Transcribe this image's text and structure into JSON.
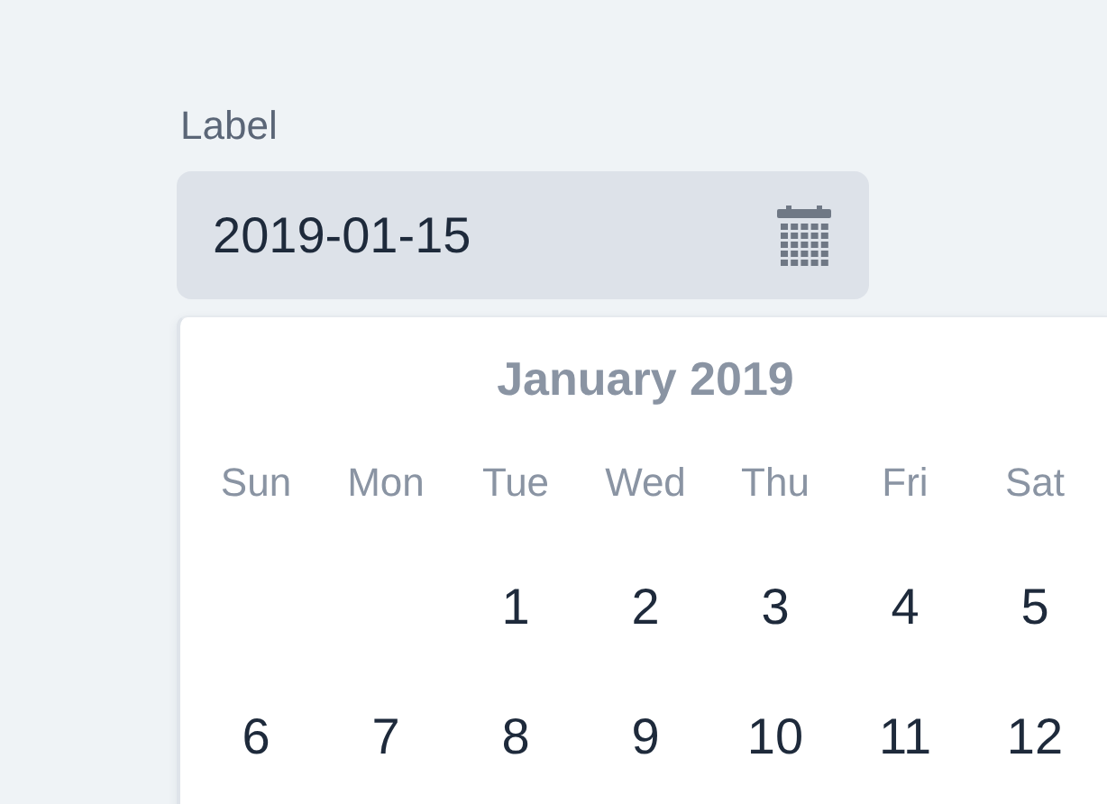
{
  "field": {
    "label": "Label",
    "value": "2019-01-15"
  },
  "calendar": {
    "title": "January 2019",
    "weekdays": [
      "Sun",
      "Mon",
      "Tue",
      "Wed",
      "Thu",
      "Fri",
      "Sat"
    ],
    "weeks": [
      [
        "1",
        "2",
        "3",
        "4",
        "5"
      ],
      [
        "6",
        "7",
        "8",
        "9",
        "10",
        "11",
        "12"
      ]
    ]
  }
}
